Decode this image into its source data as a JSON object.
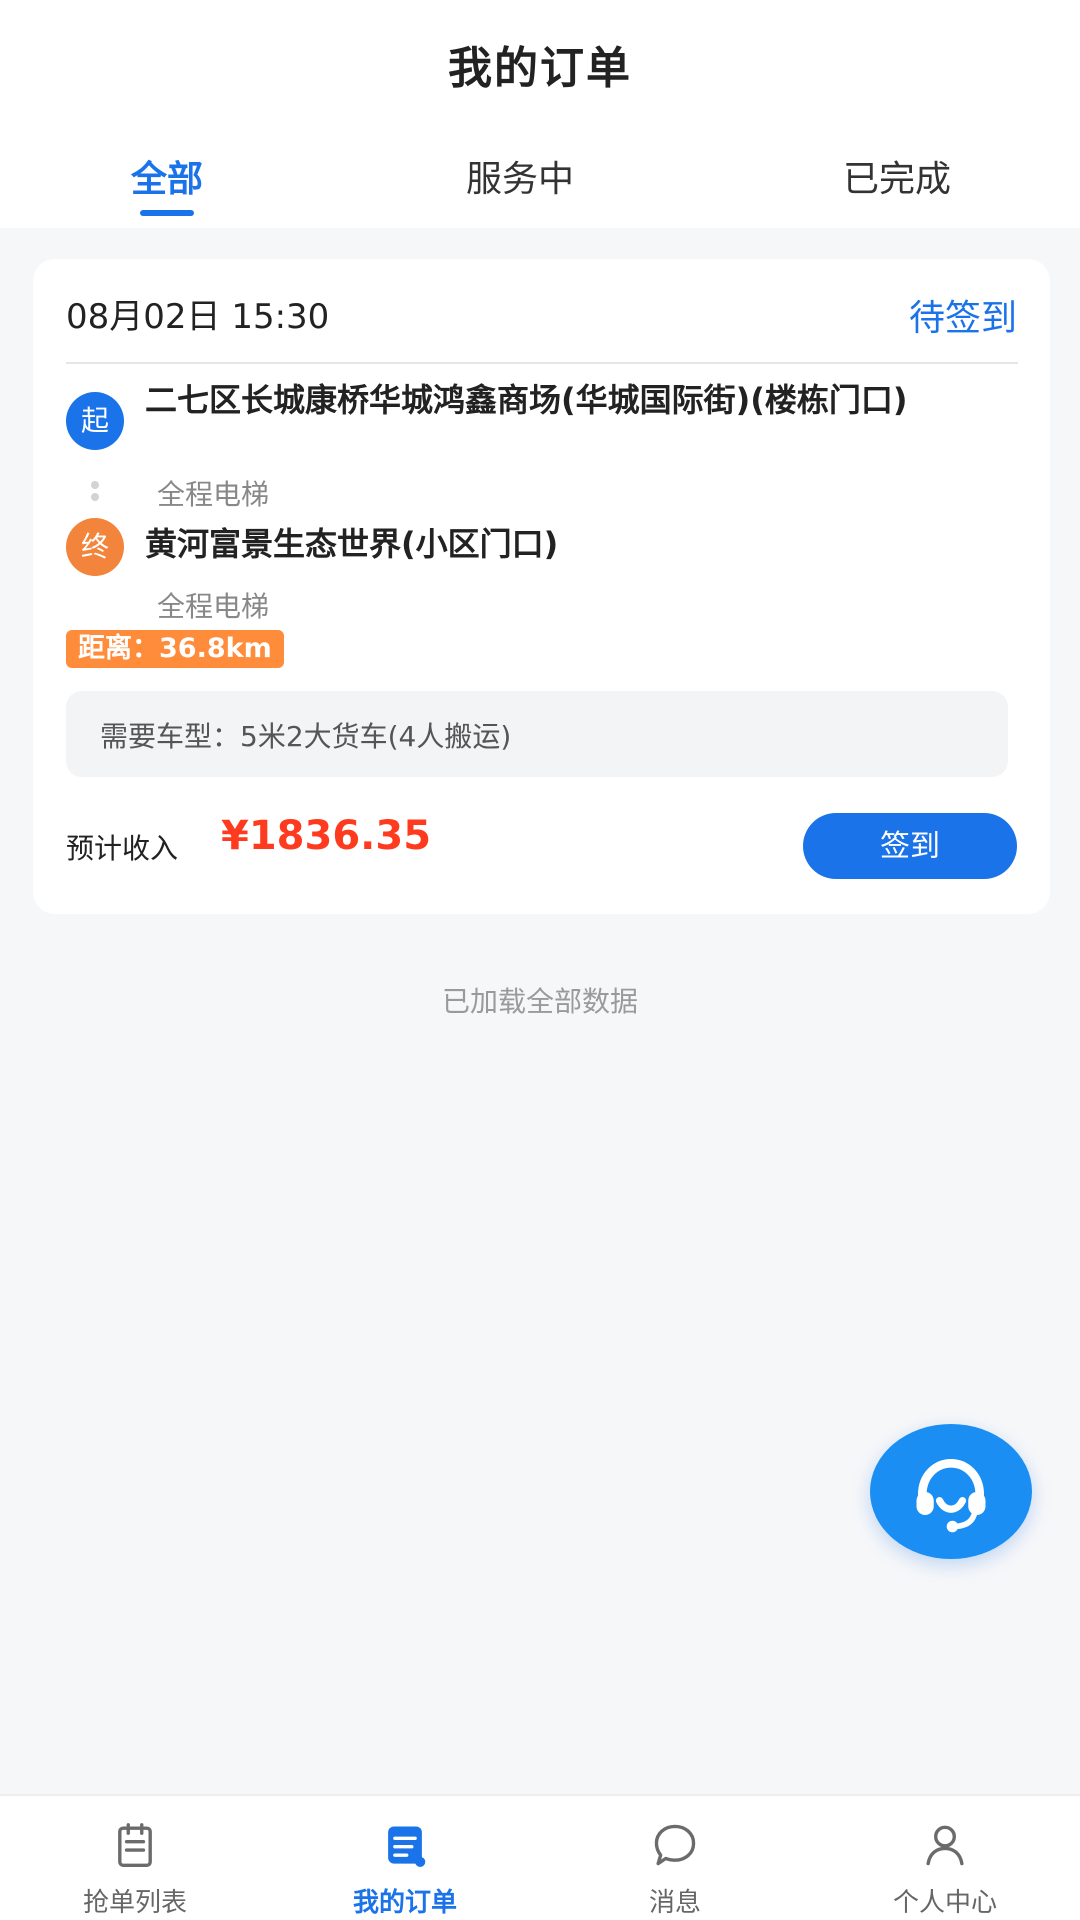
{
  "header": {
    "title": "我的订单",
    "tabs": [
      {
        "label": "全部",
        "active": true
      },
      {
        "label": "服务中",
        "active": false
      },
      {
        "label": "已完成",
        "active": false
      }
    ]
  },
  "order": {
    "datetime": "08月02日 15:30",
    "status": "待签到",
    "start": {
      "badge": "起",
      "address": "二七区长城康桥华城鸿鑫商场(华城国际街)(楼栋门口)",
      "note": "全程电梯"
    },
    "end": {
      "badge": "终",
      "address": "黄河富景生态世界(小区门口)",
      "note": "全程电梯"
    },
    "distance": "距离：36.8km",
    "vehicle": "需要车型：5米2大货车(4人搬运)",
    "income_label": "预计收入",
    "income_value": "¥1836.35",
    "checkin_label": "签到"
  },
  "list_footer": "已加载全部数据",
  "bottom_nav": [
    {
      "label": "抢单列表",
      "icon": "clipboard-icon",
      "active": false
    },
    {
      "label": "我的订单",
      "icon": "order-document-icon",
      "active": true
    },
    {
      "label": "消息",
      "icon": "chat-bubble-icon",
      "active": false
    },
    {
      "label": "个人中心",
      "icon": "user-icon",
      "active": false
    }
  ],
  "colors": {
    "primary": "#1a73e8",
    "accent_orange": "#f3843b",
    "price_red": "#ff3b1f"
  }
}
